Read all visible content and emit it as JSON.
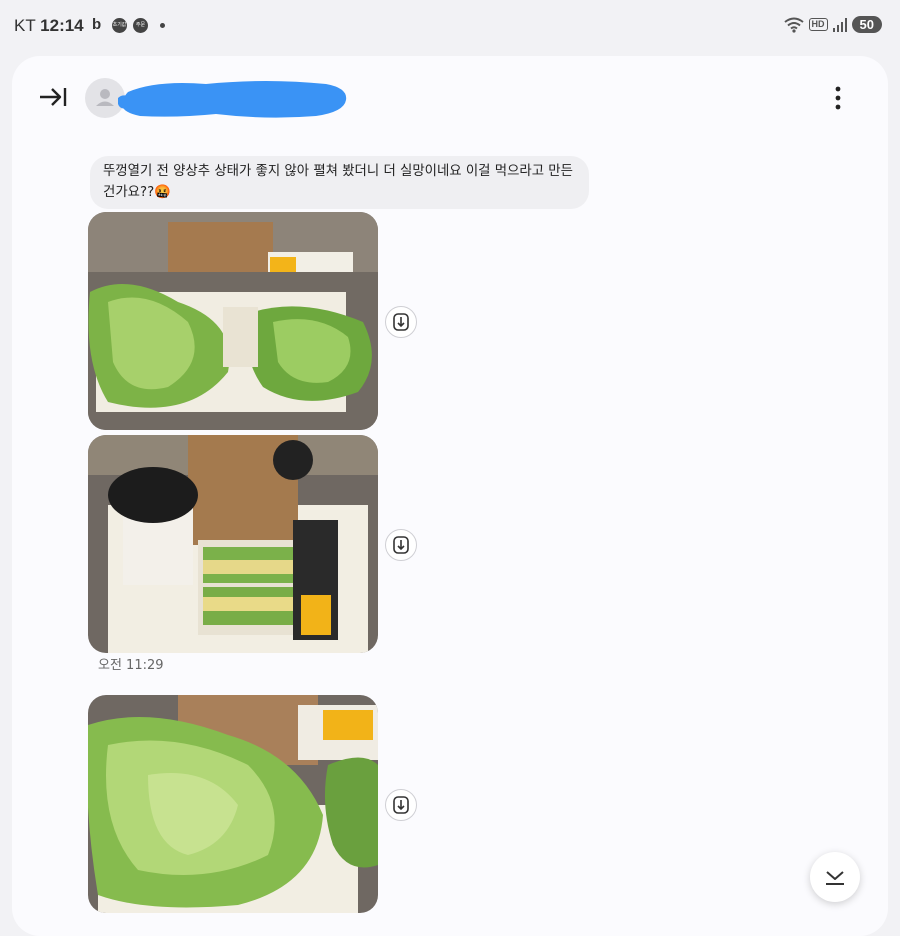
{
  "status_bar": {
    "carrier": "KT",
    "time": "12:14",
    "notif_badge_1": "초기값",
    "notif_badge_2": "주문",
    "network_badge": "HD",
    "battery": "50"
  },
  "header": {
    "back_icon": "collapse-arrow-icon",
    "more_icon": "more-vertical-icon"
  },
  "messages": [
    {
      "type": "text",
      "text": "뚜껑열기 전 양상추 상태가 좋지 않아 펼쳐 봤더니 더 실망이네요 이걸 먹으라고 만든건가요??🤬"
    },
    {
      "type": "image",
      "description_icon": "salad-photo",
      "save_icon": "save-icon"
    },
    {
      "type": "image",
      "description_icon": "sandwich-photo",
      "save_icon": "save-icon"
    },
    {
      "type": "timestamp",
      "text": "오전 11:29"
    },
    {
      "type": "image",
      "description_icon": "lettuce-photo",
      "save_icon": "save-icon"
    }
  ],
  "fab": {
    "icon": "scroll-down-icon"
  },
  "colors": {
    "bubble": "#efeff2",
    "card": "#fbfbfe",
    "background": "#f2f2f5",
    "redaction": "#3a93f5"
  }
}
